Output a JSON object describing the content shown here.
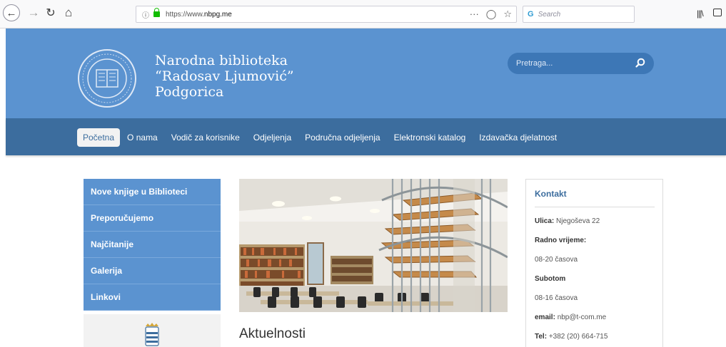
{
  "browser": {
    "url_prefix": "https://www.",
    "url_domain": "nbpg.me",
    "search_placeholder": "Search",
    "menu_dots": "···"
  },
  "header": {
    "title_line1": "Narodna biblioteka",
    "title_line2": "“Radosav Ljumović”",
    "title_line3": "Podgorica",
    "search_placeholder": "Pretraga..."
  },
  "nav": {
    "items": [
      {
        "label": "Početna"
      },
      {
        "label": "O nama"
      },
      {
        "label": "Vodič za korisnike"
      },
      {
        "label": "Odjeljenja"
      },
      {
        "label": "Područna odjeljenja"
      },
      {
        "label": "Elektronski katalog"
      },
      {
        "label": "Izdavačka djelatnost"
      }
    ]
  },
  "left_menu": {
    "items": [
      {
        "label": "Nove knjige u Biblioteci"
      },
      {
        "label": "Preporučujemo"
      },
      {
        "label": "Najčitanije"
      },
      {
        "label": "Galerija"
      },
      {
        "label": "Linkovi"
      }
    ]
  },
  "main": {
    "section_title": "Aktuelnosti"
  },
  "contact": {
    "title": "Kontakt",
    "street_label": "Ulica:",
    "street_value": "Njegoševa 22",
    "hours_label": "Radno vrijeme:",
    "hours_value": "08-20 časova",
    "saturday_label": "Subotom",
    "saturday_value": "08-16 časova",
    "email_label": "email:",
    "email_value": "nbp@t-com.me",
    "tel_label": "Tel:",
    "tel_value": "+382 (20) 664-715"
  },
  "colors": {
    "header_blue": "#5b93d0",
    "nav_blue": "#3c6d9e",
    "accent_dark": "#3d77b6"
  }
}
